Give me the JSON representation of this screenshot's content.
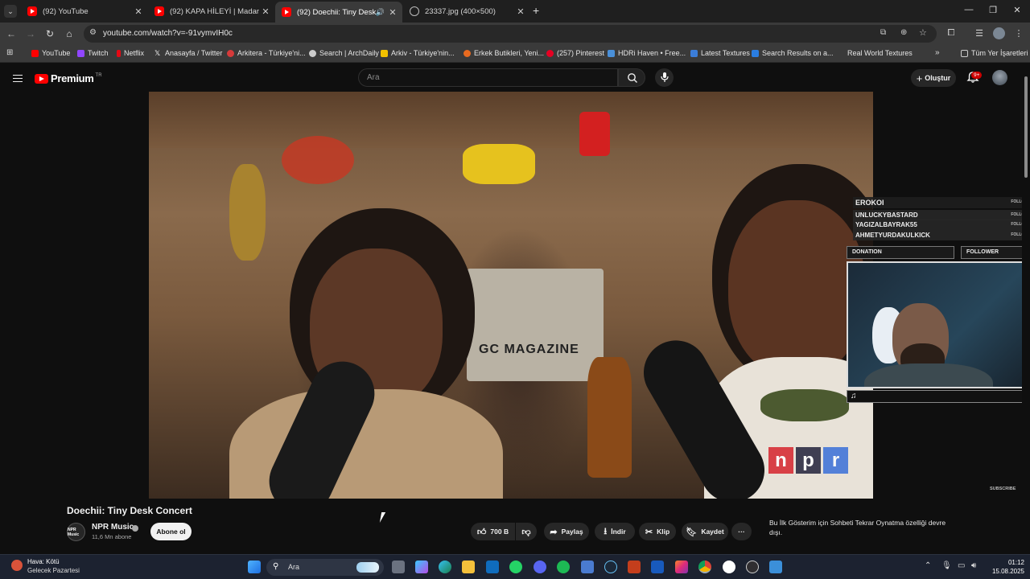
{
  "browser": {
    "tabs": [
      {
        "title": "(92) YouTube",
        "active": false
      },
      {
        "title": "(92) KAPA HİLEYİ | Madara Old...",
        "active": false
      },
      {
        "title": "(92) Doechii: Tiny Desk Con...",
        "active": true
      },
      {
        "title": "23337.jpg (400×500)",
        "active": false
      }
    ],
    "new_tab": "+",
    "url": "youtube.com/watch?v=-91vymvIH0c",
    "bookmarks": [
      {
        "label": "YouTube",
        "color": "#ff0000"
      },
      {
        "label": "Twitch",
        "color": "#9146ff"
      },
      {
        "label": "Netflix",
        "color": "#e50914"
      },
      {
        "label": "Anasayfa / Twitter",
        "color": "#ffffff"
      },
      {
        "label": "Arkitera - Türkiye'ni...",
        "color": "#d63a3a"
      },
      {
        "label": "Search | ArchDaily",
        "color": "#cccccc"
      },
      {
        "label": "Arkiv - Türkiye'nin...",
        "color": "#f2c200"
      },
      {
        "label": "Erkek Butikleri, Yeni...",
        "color": "#e86a1f"
      },
      {
        "label": "(257) Pinterest",
        "color": "#e60023"
      },
      {
        "label": "HDRi Haven • Free...",
        "color": "#4a90d9"
      },
      {
        "label": "Latest Textures",
        "color": "#3b7dd8"
      },
      {
        "label": "Search Results on a...",
        "color": "#2a7de1"
      },
      {
        "label": "Real World Textures",
        "color": "#3a3a3a"
      }
    ],
    "more_bookmarks": "»",
    "all_bookmarks": "Tüm Yer İşaretleri"
  },
  "youtube": {
    "logo_text": "Premium",
    "logo_region": "TR",
    "search_placeholder": "Ara",
    "create_label": "Oluştur",
    "notif_badge": "9+"
  },
  "video": {
    "title": "Doechii: Tiny Desk Concert",
    "channel": "NPR Music",
    "channel_avatar_text": "NPR Music",
    "subscribers": "11,6 Mn abone",
    "subscribe_label": "Abone ol",
    "likes": "700 B",
    "share_label": "Paylaş",
    "download_label": "İndir",
    "clip_label": "Klip",
    "save_label": "Kaydet",
    "more_label": "···",
    "live_message": "Bu İlk Gösterim için Sohbeti Tekrar Oynatma özelliği devre dışı.",
    "npr_letters": [
      "n",
      "p",
      "r"
    ],
    "npr_colors": [
      "#d6242d",
      "#22223b",
      "#3a6fd8"
    ]
  },
  "stream_overlay": {
    "followers": [
      {
        "name": "EROKOI",
        "tag": "FOLLOW"
      },
      {
        "name": "UNLUCKYBASTARD",
        "tag": "FOLLOW"
      },
      {
        "name": "YAGIZALBAYRAK55",
        "tag": "FOLLOW"
      },
      {
        "name": "AHMETYURDAKULKICK",
        "tag": "FOLLOW"
      }
    ],
    "donation_label": "DONATION",
    "follower_label": "FOLLOWER",
    "subscribe_mark": "SUBSCRIBE"
  },
  "taskbar": {
    "weather_title": "Hava: Kötü",
    "weather_sub": "Gelecek Pazartesi",
    "search_label": "Ara",
    "time": "01:12",
    "date": "15.08.2025"
  }
}
